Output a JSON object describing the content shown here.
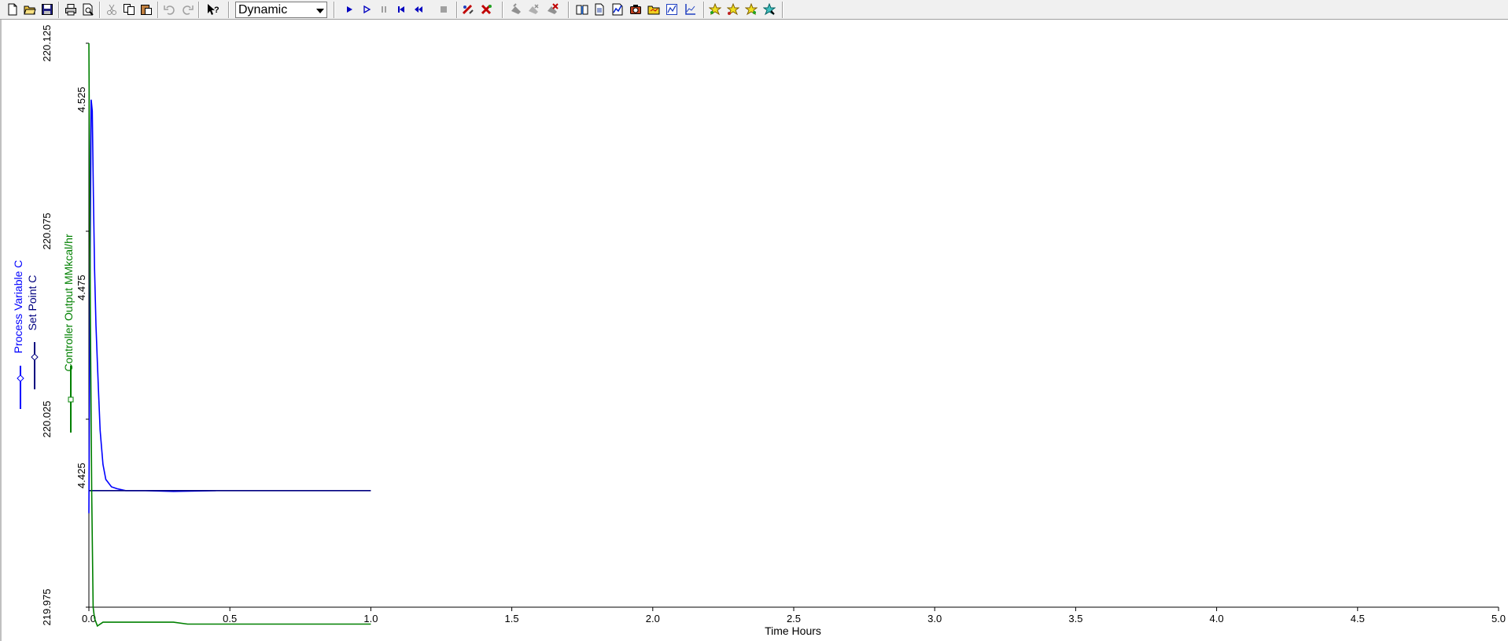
{
  "toolbar": {
    "mode_value": "Dynamic",
    "colors": {
      "background": "#f0f0f0",
      "play_blue": "#0000c0"
    },
    "groups": [
      {
        "buttons": [
          "new-file-icon",
          "open-folder-icon",
          "save-disk-icon"
        ]
      },
      {
        "buttons": [
          "print-icon",
          "print-preview-icon"
        ]
      },
      {
        "buttons": [
          "cut-icon",
          "copy-icon",
          "paste-icon"
        ]
      },
      {
        "buttons": [
          "undo-icon",
          "redo-icon"
        ]
      },
      {
        "buttons": [
          "help-pointer-icon"
        ]
      },
      {
        "buttons": [
          "mode-select"
        ]
      },
      {
        "buttons": [
          "run-icon",
          "step-icon",
          "pause-icon",
          "rewind-start-icon",
          "rewind-icon",
          "stop-icon"
        ]
      },
      {
        "buttons": [
          "tool-red-a-icon",
          "tool-red-b-icon"
        ]
      },
      {
        "buttons": [
          "tool-gray-a-icon",
          "tool-gray-b-icon",
          "tool-red-c-icon"
        ]
      },
      {
        "buttons": [
          "book-icon",
          "document-icon",
          "chart-blue-icon",
          "camera-icon",
          "folder-yellow-icon",
          "trend-icon",
          "axis-icon"
        ]
      },
      {
        "buttons": [
          "star-a-icon",
          "star-b-icon",
          "star-c-icon",
          "star-d-icon"
        ]
      }
    ]
  },
  "chart_data": {
    "type": "line",
    "xlabel": "Time Hours",
    "xlim": [
      0.0,
      5.0
    ],
    "x_ticks": [
      "0.0",
      "0.5",
      "1.0",
      "1.5",
      "2.0",
      "2.5",
      "3.0",
      "3.5",
      "4.0",
      "4.5",
      "5.0"
    ],
    "y_axes": [
      {
        "name": "temperature",
        "ylim": [
          219.975,
          220.125
        ],
        "ticks": [
          "219.975",
          "220.025",
          "220.075",
          "220.125"
        ],
        "labels": [
          "Process Variable C",
          "Set Point C"
        ]
      },
      {
        "name": "controller",
        "ylim": [
          4.39,
          4.54
        ],
        "ticks": [
          "4.425",
          "4.475",
          "4.525"
        ],
        "labels": [
          "Controller Output MMkcal/hr"
        ]
      }
    ],
    "series": [
      {
        "name": "Process Variable C",
        "axis": "temperature",
        "color": "#0000ff",
        "marker": "diamond",
        "x": [
          0.0,
          0.004,
          0.008,
          0.012,
          0.016,
          0.02,
          0.025,
          0.03,
          0.035,
          0.04,
          0.05,
          0.06,
          0.08,
          0.1,
          0.13,
          0.16,
          0.2,
          0.3,
          0.45
        ],
        "y": [
          220.0,
          220.06,
          220.11,
          220.107,
          220.085,
          220.065,
          220.05,
          220.04,
          220.031,
          220.022,
          220.013,
          220.009,
          220.007,
          220.0065,
          220.006,
          220.006,
          220.006,
          220.0058,
          220.006
        ]
      },
      {
        "name": "Set Point C",
        "axis": "temperature",
        "color": "#000080",
        "marker": "diamond",
        "x": [
          0.0,
          1.0
        ],
        "y": [
          220.006,
          220.006
        ]
      },
      {
        "name": "Controller Output MMkcal/hr",
        "axis": "controller",
        "color": "#008000",
        "marker": "square",
        "x": [
          0.0,
          0.005,
          0.01,
          0.015,
          0.02,
          0.03,
          0.05,
          0.1,
          0.3,
          0.35,
          0.6,
          1.0
        ],
        "y": [
          4.54,
          4.47,
          4.42,
          4.39,
          4.387,
          4.385,
          4.386,
          4.386,
          4.386,
          4.3855,
          4.3855,
          4.3855
        ]
      }
    ]
  }
}
